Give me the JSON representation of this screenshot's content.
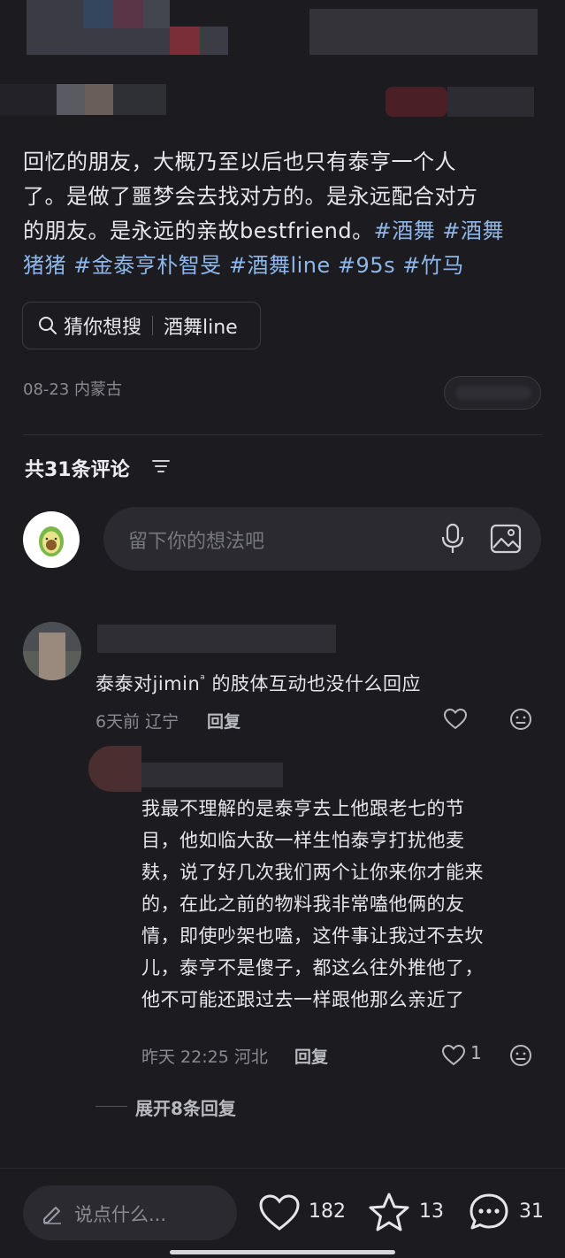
{
  "post": {
    "text_line1": "回忆的朋友，大概乃至以后也只有泰亨一个人",
    "text_line2": "了。是做了噩梦会去找对方的。是永远配合对方",
    "text_line3": "的朋友。是永远的亲故bestfriend。",
    "tags_line3": "#酒舞 #酒舞",
    "tags_line4": "猪猪 #金泰亨朴智旻 #酒舞line #95s #竹马"
  },
  "search_chip": {
    "icon": "search-icon",
    "prefix": "猜你想搜",
    "term": "酒舞line"
  },
  "meta": {
    "date_location": "08-23 内蒙古"
  },
  "comments_header": {
    "count_label": "共31条评论",
    "icon": "filter-icon"
  },
  "comment_input": {
    "placeholder": "留下你的想法吧",
    "icons": [
      "mic-icon",
      "image-icon"
    ]
  },
  "comments": [
    {
      "text_before": "泰泰对",
      "mention": "jimin",
      "text_after": "的肢体互动也没什么回应",
      "time_location": "6天前 辽宁",
      "reply_label": "回复"
    }
  ],
  "reply": {
    "lines": [
      "我最不理解的是泰亨去上他跟老七的节",
      "目，他如临大敌一样生怕泰亨打扰他麦",
      "麸，说了好几次我们两个让你来你才能来",
      "的，在此之前的物料我非常嗑他俩的友",
      "情，即使吵架也嗑，这件事让我过不去坎",
      "儿，泰亨不是傻子，都这么往外推他了，",
      "他不可能还跟过去一样跟他那么亲近了"
    ],
    "time_location": "昨天 22:25 河北",
    "reply_label": "回复",
    "like_count": "1"
  },
  "expand_label": "展开8条回复",
  "bottom_bar": {
    "say_placeholder": "说点什么...",
    "like_count": "182",
    "star_count": "13",
    "comment_count": "31"
  },
  "colors": {
    "background": "#1b1b20",
    "tag": "#8fb6e8",
    "muted": "#8a8a92"
  }
}
